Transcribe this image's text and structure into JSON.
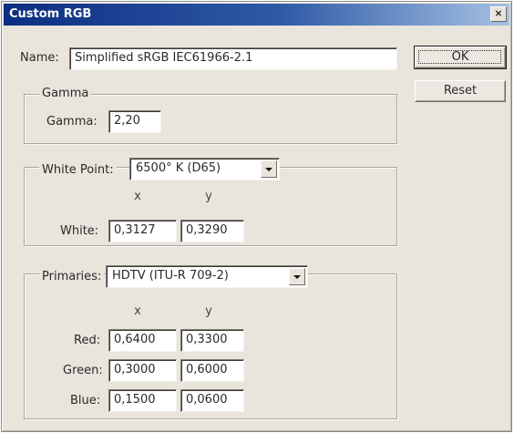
{
  "window": {
    "title": "Custom RGB",
    "close_label": "×"
  },
  "name_field": {
    "label": "Name:",
    "value": "Simplified sRGB IEC61966-2.1"
  },
  "buttons": {
    "ok_label": "OK",
    "reset_label": "Reset"
  },
  "gamma_group": {
    "title": "Gamma",
    "label": "Gamma:",
    "value": "2,20"
  },
  "white_point_group": {
    "label": "White Point:",
    "selected": "6500° K (D65)",
    "x_header": "x",
    "y_header": "y",
    "white_label": "White:",
    "white_x": "0,3127",
    "white_y": "0,3290"
  },
  "primaries_group": {
    "label": "Primaries:",
    "selected": "HDTV (ITU-R 709-2)",
    "x_header": "x",
    "y_header": "y",
    "rows": [
      {
        "label": "Red:",
        "x": "0,6400",
        "y": "0,3300"
      },
      {
        "label": "Green:",
        "x": "0,3000",
        "y": "0,6000"
      },
      {
        "label": "Blue:",
        "x": "0,1500",
        "y": "0,0600"
      }
    ]
  }
}
